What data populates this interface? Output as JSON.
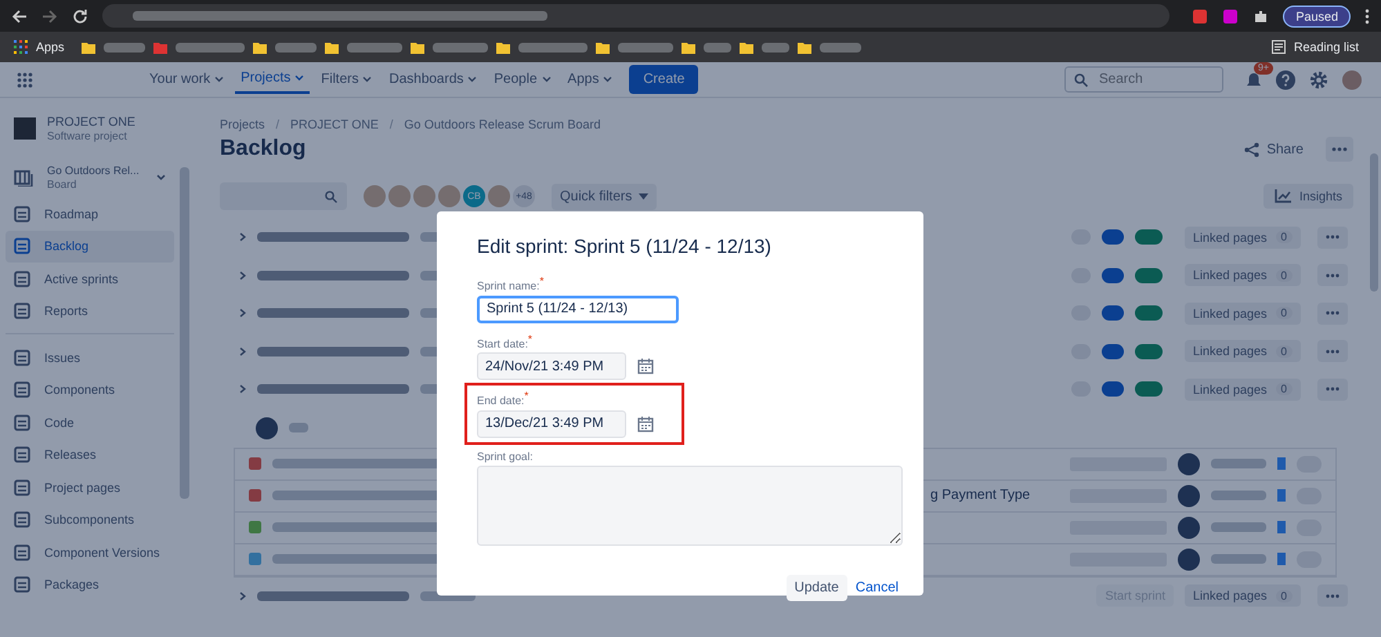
{
  "browser": {
    "apps": "Apps",
    "reading_list": "Reading list",
    "profile": "Paused"
  },
  "nav": {
    "items": [
      {
        "label": "Your work",
        "selected": false
      },
      {
        "label": "Projects",
        "selected": true
      },
      {
        "label": "Filters",
        "selected": false
      },
      {
        "label": "Dashboards",
        "selected": false
      },
      {
        "label": "People",
        "selected": false
      },
      {
        "label": "Apps",
        "selected": false
      }
    ],
    "create": "Create",
    "search": {
      "placeholder": "Search"
    },
    "notifications_badge": "9+"
  },
  "sidebar": {
    "project_name": "PROJECT ONE",
    "project_type": "Software project",
    "board_name": "Go Outdoors Rel...",
    "board_type": "Board",
    "items": [
      {
        "label": "Roadmap",
        "selected": false
      },
      {
        "label": "Backlog",
        "selected": true
      },
      {
        "label": "Active sprints",
        "selected": false
      },
      {
        "label": "Reports",
        "selected": false
      },
      {
        "label": "Issues",
        "selected": false
      },
      {
        "label": "Components",
        "selected": false
      },
      {
        "label": "Code",
        "selected": false
      },
      {
        "label": "Releases",
        "selected": false
      },
      {
        "label": "Project pages",
        "selected": false
      },
      {
        "label": "Subcomponents",
        "selected": false
      },
      {
        "label": "Component Versions",
        "selected": false
      },
      {
        "label": "Packages",
        "selected": false
      }
    ]
  },
  "page": {
    "breadcrumbs": [
      {
        "kind": "link",
        "text": "Projects"
      },
      {
        "kind": "separator",
        "text": "/"
      },
      {
        "kind": "link",
        "text": "PROJECT ONE"
      },
      {
        "kind": "separator",
        "text": "/"
      },
      {
        "kind": "link",
        "text": "Go Outdoors Release Scrum Board"
      }
    ],
    "title": "Backlog",
    "share": "Share",
    "avatar_initials": "CB",
    "avatar_overflow": "+48",
    "quick_filters": "Quick filters",
    "insights": "Insights"
  },
  "sprints": [
    {
      "linked_pages": "Linked pages",
      "linked_count": "0"
    },
    {
      "linked_pages": "Linked pages",
      "linked_count": "0"
    },
    {
      "linked_pages": "Linked pages",
      "linked_count": "0"
    },
    {
      "linked_pages": "Linked pages",
      "linked_count": "0"
    },
    {
      "linked_pages": "Linked pages",
      "linked_count": "0"
    }
  ],
  "issues": [
    {
      "color": "#843b43"
    },
    {
      "color": "#843b43",
      "summary_tail": "g Payment Type"
    },
    {
      "color": "#3f7744"
    },
    {
      "color": "#33709f"
    }
  ],
  "next_sprint": {
    "start_sprint": "Start sprint",
    "linked_pages": "Linked pages",
    "linked_count": "0"
  },
  "dialog": {
    "title": "Edit sprint: Sprint 5 (11/24 - 12/13)",
    "fields": [
      {
        "kind": "text",
        "label": "Sprint name:",
        "required_mark": "*",
        "value": "Sprint 5 (11/24 - 12/13)",
        "focused": true,
        "highlighted": false
      },
      {
        "kind": "date",
        "label": "Start date:",
        "required_mark": "*",
        "value": "24/Nov/21 3:49 PM",
        "focused": false,
        "highlighted": false
      },
      {
        "kind": "date",
        "label": "End date:",
        "required_mark": "*",
        "value": "13/Dec/21 3:49 PM",
        "focused": false,
        "highlighted": true
      },
      {
        "kind": "textarea",
        "label": "Sprint goal:",
        "focused": false,
        "highlighted": false
      }
    ],
    "update": "Update",
    "cancel": "Cancel"
  }
}
